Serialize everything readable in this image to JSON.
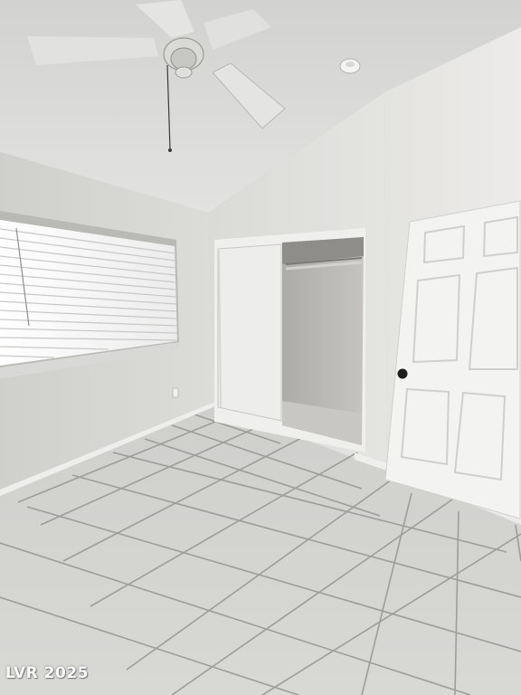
{
  "watermark": {
    "text": "LVR 2025"
  },
  "colors": {
    "ceiling": "#dcdcda",
    "wall_left": "#d6d6d3",
    "wall_back": "#dedddb",
    "wall_right": "#e6e5e3",
    "floor_tile": "#d3d3d0",
    "grout": "#9a9a96",
    "door": "#f2f2f0",
    "closet_interior": "#bdbbb7",
    "window_blinds": "#f4f4f4"
  },
  "icons": {
    "fan": "ceiling-fan-icon",
    "smoke_detector": "smoke-detector-icon",
    "door_knob": "door-knob-icon",
    "outlet": "outlet-icon"
  }
}
